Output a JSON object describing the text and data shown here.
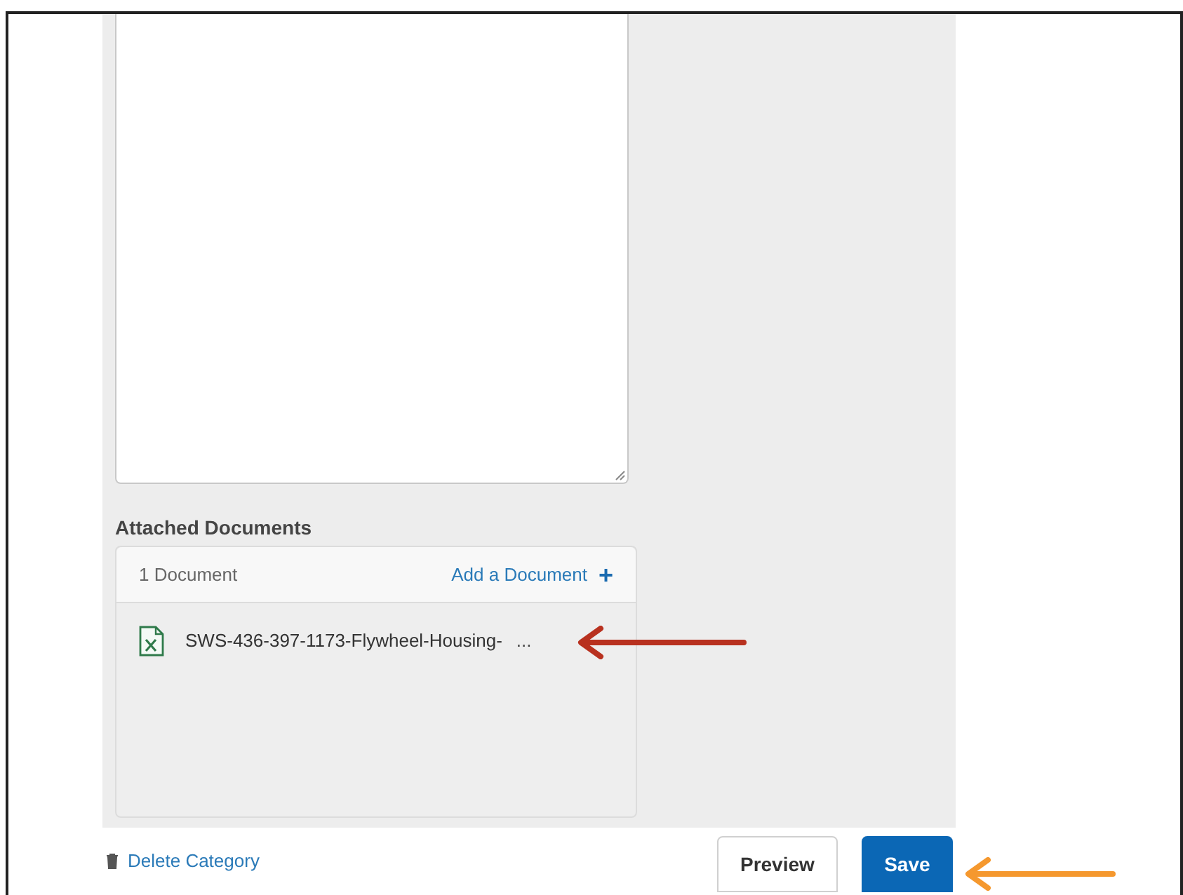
{
  "attached_documents": {
    "title": "Attached Documents",
    "count": "1 Document",
    "add_link": "Add a Document",
    "plus": "+",
    "files": [
      {
        "name": "SWS-436-397-1173-Flywheel-Housing-",
        "more": "..."
      }
    ]
  },
  "footer": {
    "delete_link": "Delete Category",
    "buttons": [
      {
        "label": "Preview",
        "kind": "secondary"
      },
      {
        "label": "Save",
        "kind": "primary"
      }
    ]
  }
}
